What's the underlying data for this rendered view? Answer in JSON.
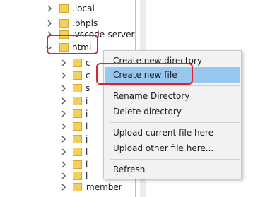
{
  "tree": {
    "items": [
      {
        "label": ".local"
      },
      {
        "label": ".phpls"
      },
      {
        "label": ".vscode-server"
      },
      {
        "label": "html"
      }
    ],
    "children": [
      "c",
      "c",
      "s",
      "i",
      "i",
      "i",
      "j",
      "l",
      "l",
      "l"
    ],
    "last_child": "member"
  },
  "context_menu": {
    "items": [
      {
        "label": "Create new directory"
      },
      {
        "label": "Create new file"
      },
      {
        "label": "Rename Directory"
      },
      {
        "label": "Delete directory"
      },
      {
        "label": "Upload current file here"
      },
      {
        "label": "Upload other file here..."
      },
      {
        "label": "Refresh"
      }
    ]
  },
  "colors": {
    "highlight": "#98c8f0",
    "annotation_ring": "#e0202a",
    "folder": "#f5cf5b"
  },
  "icons": [
    "chevron-right-icon",
    "chevron-down-icon",
    "folder-icon"
  ]
}
